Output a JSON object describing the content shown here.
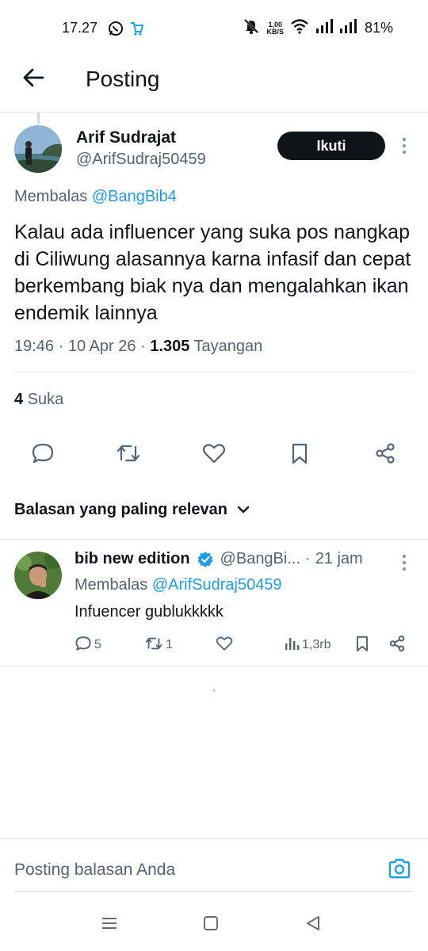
{
  "status_bar": {
    "time": "17.27",
    "net_speed_value": "1,00",
    "net_speed_unit": "KB/S",
    "battery": "81%"
  },
  "header": {
    "title": "Posting"
  },
  "post": {
    "author_name": "Arif Sudrajat",
    "author_handle": "@ArifSudraj50459",
    "follow_label": "Ikuti",
    "replying_prefix": "Membalas",
    "replying_to": "@BangBib4",
    "text": "Kalau ada influencer yang suka pos nangkap di Ciliwung alasannya karna infasif dan cepat berkembang biak nya dan mengalahkan ikan endemik lainnya",
    "time": "19:46",
    "date": "10 Apr 26",
    "views_count": "1.305",
    "views_label": "Tayangan",
    "likes_count": "4",
    "likes_label": "Suka"
  },
  "sort": {
    "label": "Balasan yang paling relevan"
  },
  "reply": {
    "name": "bib new edition",
    "handle": "@BangBi...",
    "time": "21 jam",
    "replying_prefix": "Membalas",
    "replying_to": "@ArifSudraj50459",
    "text": "Infuencer gublukkkkk",
    "comment_count": "5",
    "repost_count": "1",
    "views_count": "1,3rb"
  },
  "composer": {
    "placeholder": "Posting balasan Anda"
  },
  "colors": {
    "accent": "#1d9bf0",
    "text": "#0f1419",
    "muted": "#536471",
    "divider": "#e6e9eb",
    "verified": "#1d9bf0"
  },
  "icons": {
    "back": "arrow-left-icon",
    "more": "more-vertical-icon",
    "reply": "comment-icon",
    "repost": "repost-icon",
    "like": "heart-icon",
    "bookmark": "bookmark-icon",
    "share": "share-icon",
    "views": "analytics-icon",
    "camera": "camera-icon",
    "verified": "verified-badge-icon"
  }
}
